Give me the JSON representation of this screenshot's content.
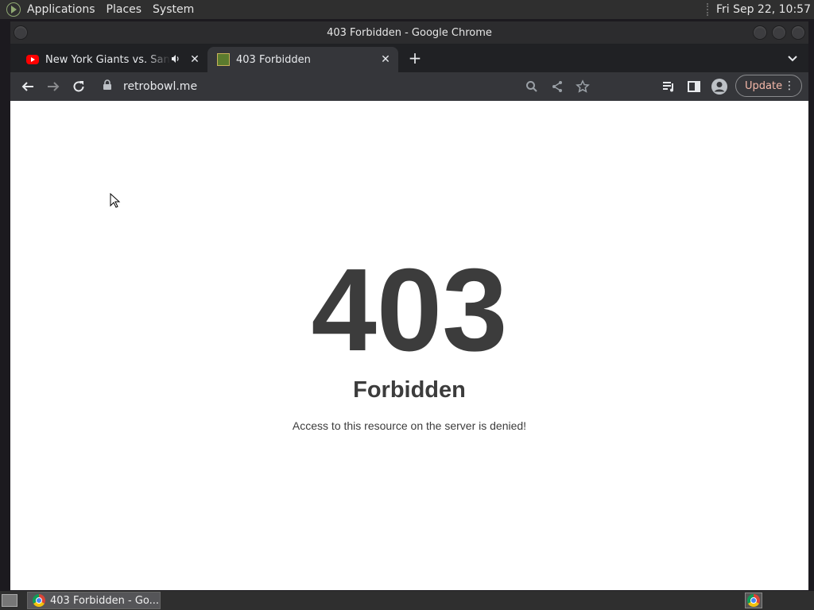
{
  "top_panel": {
    "menus": [
      "Applications",
      "Places",
      "System"
    ],
    "clock": "Fri Sep 22, 10:57"
  },
  "window": {
    "title": "403 Forbidden - Google Chrome"
  },
  "tabs": [
    {
      "title": "New York Giants vs. San Francisco",
      "favicon": "youtube-icon",
      "audio": true,
      "active": false
    },
    {
      "title": "403 Forbidden",
      "favicon": "retrobowl-icon",
      "audio": false,
      "active": true
    }
  ],
  "toolbar": {
    "url": "retrobowl.me",
    "update_label": "Update"
  },
  "page": {
    "code": "403",
    "title": "Forbidden",
    "message": "Access to this resource on the server is denied!"
  },
  "taskbar": {
    "item_label": "403 Forbidden - Go..."
  },
  "colors": {
    "panel_bg": "#2f2f2f",
    "chrome_dark": "#202124",
    "toolbar_bg": "#35363a",
    "update_text": "#f5b8a9",
    "error_text": "#3c3c3c"
  }
}
